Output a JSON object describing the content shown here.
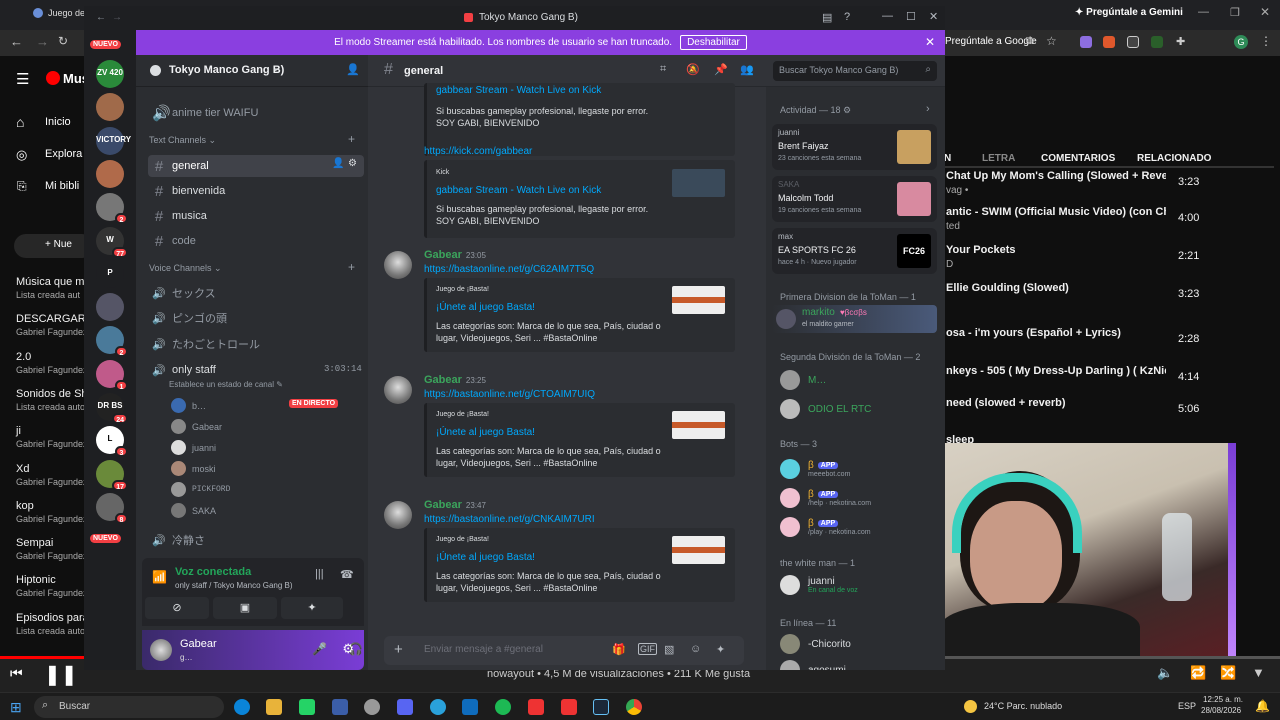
{
  "browser": {
    "tab_title": "Juego de",
    "gemini_label": "Pregúntale a Gemini",
    "ask_google": "Pregúntale a Google",
    "yt_logo": "Mus",
    "sidebar": {
      "home": "Inicio",
      "explore": "Explora",
      "library": "Mi bibli",
      "new_btn": "Nue",
      "playlists": [
        {
          "title": "Música que me",
          "sub": "Lista creada aut"
        },
        {
          "title": "DESCARGAR",
          "sub": "Gabriel Fagundez"
        },
        {
          "title": "2.0",
          "sub": "Gabriel Fagundez"
        },
        {
          "title": "Sonidos de Shor",
          "sub": "Lista creada autom"
        },
        {
          "title": "ji",
          "sub": "Gabriel Fagundez"
        },
        {
          "title": "Xd",
          "sub": "Gabriel Fagundez"
        },
        {
          "title": "kop",
          "sub": "Gabriel Fagundez"
        },
        {
          "title": "Sempai",
          "sub": "Gabriel Fagundez"
        },
        {
          "title": "Hiptonic",
          "sub": "Gabriel Fagundez"
        },
        {
          "title": "Episodios para r",
          "sub": "Lista creada autom"
        }
      ]
    },
    "right_tabs": [
      "N",
      "LETRA",
      "COMENTARIOS",
      "RELACIONADO"
    ],
    "queue": [
      {
        "title": "Chat Up My Mom's Calling (Slowed + Reve…",
        "sub": "vag •",
        "dur": "3:23"
      },
      {
        "title": "antic - SWIM (Official Music Video) (con Cha…",
        "sub": "ted",
        "dur": "4:00"
      },
      {
        "title": "Your Pockets",
        "sub": "D",
        "dur": "2:21"
      },
      {
        "title": "Ellie Goulding (Slowed)",
        "sub": "",
        "dur": "3:23"
      },
      {
        "title": "osa - i'm yours (Español + Lyrics)",
        "sub": "",
        "dur": "2:28"
      },
      {
        "title": "nkeys - 505 ( My Dress-Up Darling ) ( KzNicx…",
        "sub": "",
        "dur": "4:14"
      },
      {
        "title": "need (slowed + reverb)",
        "sub": "",
        "dur": "5:06"
      },
      {
        "title": "sleep",
        "sub": "",
        "dur": ""
      }
    ],
    "player": {
      "now_playing": "nowayout • 4,5 M de visualizaciones • 211 K Me gusta",
      "progress": 0.17
    }
  },
  "taskbar": {
    "search_placeholder": "Buscar",
    "weather": "24°C  Parc. nublado",
    "lang": "ESP",
    "time": "12:25 a. m.",
    "date": "28/08/2026"
  },
  "discord": {
    "window_title": "Tokyo Manco Gang B)",
    "streamer_banner": "El modo Streamer está habilitado. Los nombres de usuario se han truncado.",
    "streamer_button": "Deshabilitar",
    "server_name": "Tokyo Manco Gang B)",
    "new_badge": "NUEVO",
    "servers": [
      {
        "label": "ZV 420",
        "badge": ""
      },
      {
        "label": "",
        "badge": ""
      },
      {
        "label": "VICTORY",
        "badge": ""
      },
      {
        "label": "",
        "badge": ""
      },
      {
        "label": "",
        "badge": "2"
      },
      {
        "label": "W",
        "badge": "77"
      },
      {
        "label": "P",
        "badge": ""
      },
      {
        "label": "",
        "badge": ""
      },
      {
        "label": "",
        "badge": "2"
      },
      {
        "label": "",
        "badge": "1"
      },
      {
        "label": "DR BS",
        "badge": "24"
      },
      {
        "label": "L",
        "badge": "3"
      },
      {
        "label": "",
        "badge": "17"
      },
      {
        "label": "",
        "badge": "8"
      }
    ],
    "top_channel": "anime tier WAIFU",
    "text_category": "Text Channels",
    "text_channels": [
      "general",
      "bienvenida",
      "musica",
      "code"
    ],
    "voice_category": "Voice Channels",
    "voice_channels": [
      "セックス",
      "ピンゴの頭",
      "たわごとトロール"
    ],
    "only_staff": {
      "name": "only staff",
      "timer": "3:03:14",
      "status_prompt": "Establece un estado de canal",
      "live_badge": "EN DIRECTO",
      "users": [
        "b…",
        "Gabear",
        "juanni",
        "moski",
        "PICKFORD",
        "SAKA"
      ]
    },
    "after_voice": "冷静さ",
    "voice_connected": {
      "title": "Voz conectada",
      "sub": "only staff / Tokyo Manco Gang B)"
    },
    "user_panel": {
      "name": "Gabear",
      "status": "g…"
    },
    "chat": {
      "channel": "general",
      "search_placeholder": "Buscar Tokyo Manco Gang B)",
      "input_placeholder": "Enviar mensaje a #general",
      "top_embed": {
        "title": "gabbear Stream - Watch Live on Kick",
        "desc": "Si buscabas gameplay profesional, llegaste por error. SOY GABI, BIENVENIDO"
      },
      "kick_link": "https://kick.com/gabbear",
      "kick_embed": {
        "provider": "Kick",
        "title": "gabbear Stream - Watch Live on Kick",
        "desc": "Si buscabas gameplay profesional, llegaste por error. SOY GABI, BIENVENIDO"
      },
      "messages": [
        {
          "author": "Gabear",
          "time": "23:05",
          "link": "https://bastaonline.net/g/C62AIM7T5Q",
          "provider": "Juego de ¡Basta!",
          "title": "¡Únete al juego Basta!",
          "desc": "Las categorías son: Marca de lo que sea, País, ciudad o lugar, Videojuegos, Seri ... #BastaOnline"
        },
        {
          "author": "Gabear",
          "time": "23:25",
          "link": "https://bastaonline.net/g/CTOAIM7UIQ",
          "provider": "Juego de ¡Basta!",
          "title": "¡Únete al juego Basta!",
          "desc": "Las categorías son: Marca de lo que sea, País, ciudad o lugar, Videojuegos, Seri ... #BastaOnline"
        },
        {
          "author": "Gabear",
          "time": "23:47",
          "link": "https://bastaonline.net/g/CNKAIM7URI",
          "provider": "Juego de ¡Basta!",
          "title": "¡Únete al juego Basta!",
          "desc": "Las categorías son: Marca de lo que sea, País, ciudad o lugar, Videojuegos, Seri ... #BastaOnline"
        }
      ]
    },
    "members": {
      "activity_header": "Actividad — 18",
      "activities": [
        {
          "user": "juanni",
          "title": "Brent Faiyaz",
          "sub": "23 canciones esta semana"
        },
        {
          "user": "SAKA",
          "title": "Malcolm Todd",
          "sub": "19 canciones esta semana"
        },
        {
          "user": "max",
          "title": "EA SPORTS FC 26",
          "sub": "hace 4 h · Nuevo jugador",
          "thumb": "FC26"
        }
      ],
      "group1": "Primera Division de la ToMan — 1",
      "markito": {
        "name": "markito",
        "tag": "βcσβs",
        "status": "el maldito gamer"
      },
      "group2": "Segunda División de la ToMan — 2",
      "group2_members": [
        "M…",
        "ODIO EL RTC"
      ],
      "bots_header": "Bots — 3",
      "bots": [
        {
          "name": "β",
          "tag": "APP",
          "status": "meeebot.com"
        },
        {
          "name": "β",
          "tag": "APP",
          "status": "/help · nekotina.com"
        },
        {
          "name": "β",
          "tag": "APP",
          "status": "/play · nekotina.com"
        }
      ],
      "group3": "the white man — 1",
      "juanni": {
        "name": "juanni",
        "status": "En canal de voz"
      },
      "online_header": "En línea — 11",
      "online": [
        "-Chicorito",
        "agosumi"
      ]
    }
  }
}
